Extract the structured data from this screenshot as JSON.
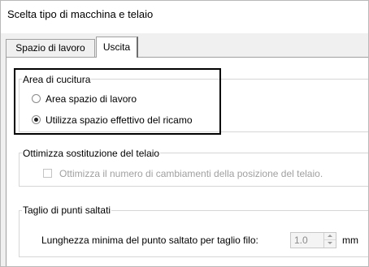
{
  "dialog": {
    "title": "Scelta tipo di macchina e telaio"
  },
  "tabs": [
    {
      "label": "Spazio di lavoro",
      "selected": false
    },
    {
      "label": "Uscita",
      "selected": true
    }
  ],
  "sewing_area": {
    "label": "Area di cucitura",
    "options": [
      {
        "label": "Area spazio di lavoro",
        "selected": false
      },
      {
        "label": "Utilizza spazio effettivo del ricamo",
        "selected": true
      }
    ]
  },
  "hoop_optimize": {
    "label": "Ottimizza sostituzione del telaio",
    "checkbox_label": "Ottimizza il numero di cambiamenti della posizione del telaio.",
    "checked": false,
    "enabled": false
  },
  "jump_trim": {
    "label": "Taglio di punti saltati",
    "field_label": "Lunghezza minima del punto saltato per taglio filo:",
    "value": "1.0",
    "unit": "mm",
    "enabled": false
  }
}
